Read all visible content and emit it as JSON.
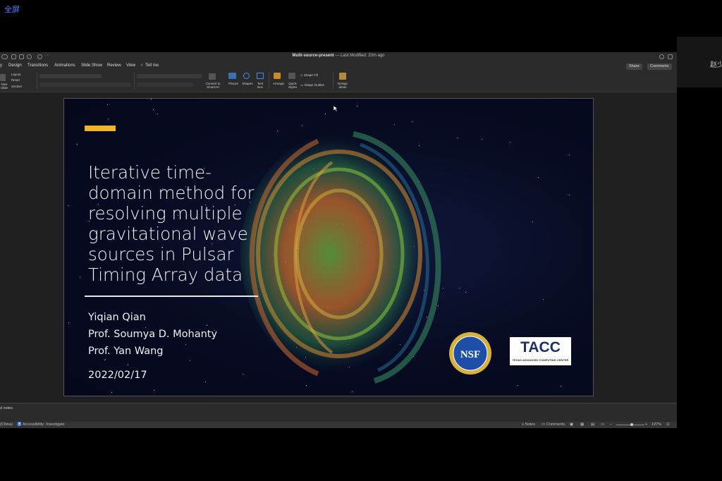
{
  "overlay": {
    "fullscreen_label": "全屏",
    "participant_name": "赵少"
  },
  "app": {
    "document_title": "Multi-source-present",
    "last_modified": " — Last Modified: 20m ago",
    "menu": [
      "y",
      "Design",
      "Transitions",
      "Animations",
      "Slide Show",
      "Review",
      "View",
      "Tell me"
    ],
    "share_label": "Share",
    "comments_label": "Comments",
    "ribbon": {
      "new_slide": "New Slide",
      "layout": "Layout",
      "reset": "Reset",
      "section": "Section",
      "convert_smartart": "Convert to SmartArt",
      "picture": "Picture",
      "shapes": "Shapes",
      "text_box": "Text Box",
      "arrange": "Arrange",
      "quick_styles": "Quick Styles",
      "shape_fill": "Shape Fill",
      "shape_outline": "Shape Outline",
      "design_ideas": "Design Ideas"
    }
  },
  "slide": {
    "title": "Iterative time-domain method for resolving multiple gravitational wave sources in Pulsar Timing Array data",
    "authors": [
      "Yiqian Qian",
      "Prof. Soumya D. Mohanty",
      "Prof. Yan Wang"
    ],
    "date": "2022/02/17",
    "logos": {
      "nsf": "NSF",
      "tacc": "TACC",
      "tacc_sub": "TEXAS ADVANCED COMPUTING CENTER"
    },
    "accent_color": "#f0b42a"
  },
  "notes_label": "d notes",
  "status": {
    "language": "(China)",
    "accessibility": "Accessibility: Investigate",
    "notes": "Notes",
    "comments": "Comments",
    "zoom": "197%"
  }
}
